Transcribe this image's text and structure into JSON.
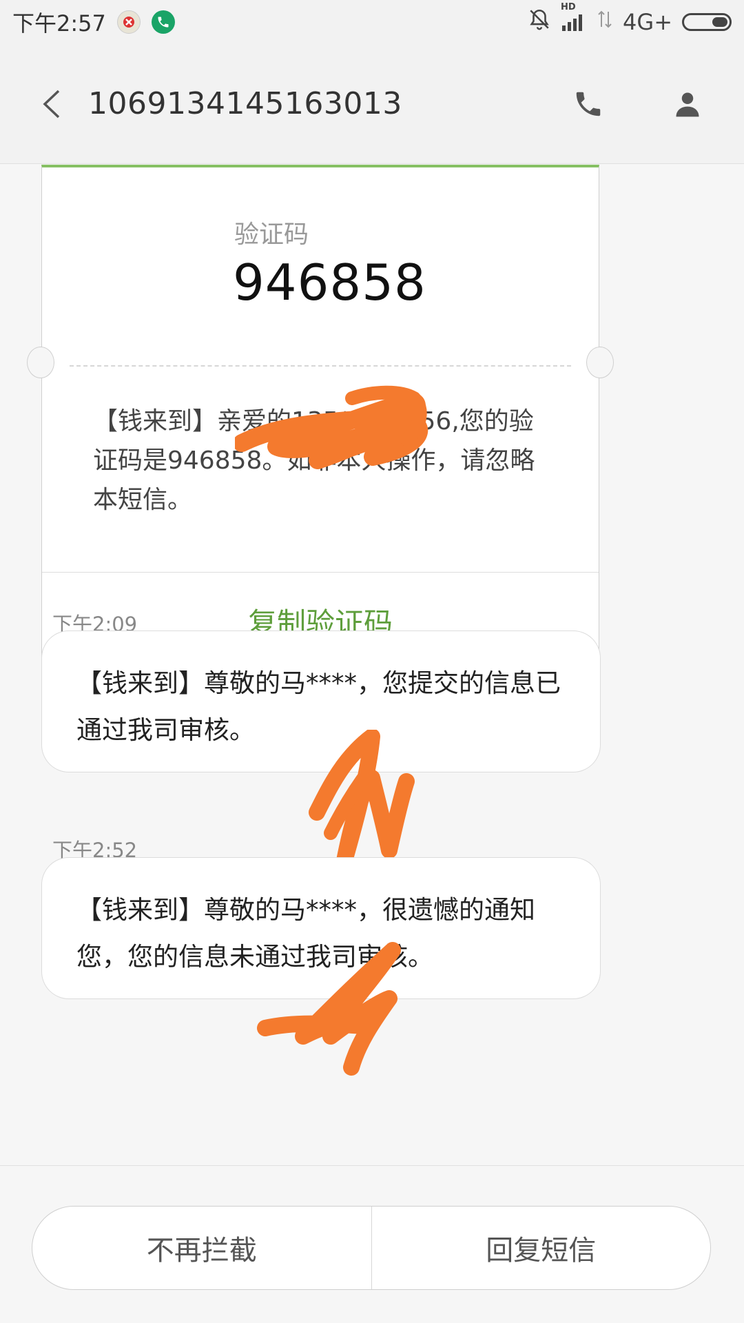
{
  "status_bar": {
    "time": "下午2:57",
    "network": "4G+",
    "hd_label": "HD"
  },
  "header": {
    "back_icon": "chevron-left-icon",
    "title": "1069134145163013",
    "call_icon": "phone-icon",
    "contact_icon": "person-icon"
  },
  "code_card": {
    "label": "验证码",
    "code": "946858",
    "body": "【钱来到】亲爱的135****5856,您的验证码是946858。如非本人操作，请忽略本短信。",
    "copy_label": "复制验证码",
    "accent_color": "#86c063",
    "copy_color": "#5e9e3b"
  },
  "messages": [
    {
      "time": "下午2:09",
      "text": "【钱来到】尊敬的马****，您提交的信息已通过我司审核。"
    },
    {
      "time": "下午2:52",
      "text": "【钱来到】尊敬的马****，很遗憾的通知您，您的信息未通过我司审核。"
    }
  ],
  "bottom_actions": {
    "unblock_label": "不再拦截",
    "reply_label": "回复短信"
  },
  "redaction_color": "#f47a2e"
}
